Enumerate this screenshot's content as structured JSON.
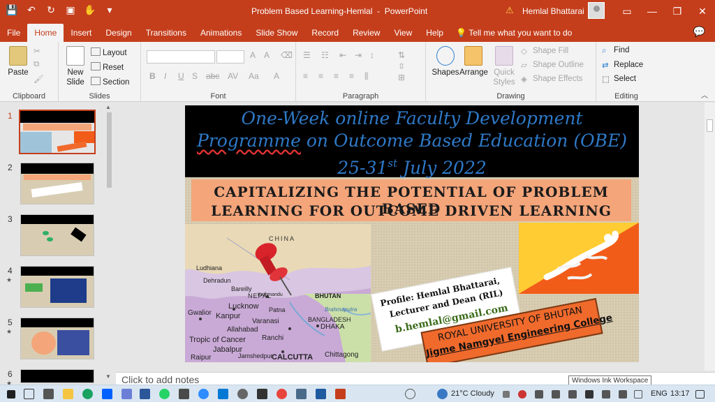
{
  "app": {
    "doc_title": "Problem Based Learning-Hemlal",
    "app_name": "PowerPoint",
    "title_separator": "-",
    "user_name": "Hemlal Bhattarai"
  },
  "tabs": [
    "File",
    "Home",
    "Insert",
    "Design",
    "Transitions",
    "Animations",
    "Slide Show",
    "Record",
    "Review",
    "View",
    "Help"
  ],
  "active_tab": "Home",
  "tell_me": "Tell me what you want to do",
  "ribbon": {
    "clipboard": {
      "paste": "Paste",
      "label": "Clipboard"
    },
    "slides": {
      "new_slide": "New",
      "new_slide2": "Slide",
      "layout": "Layout",
      "reset": "Reset",
      "section": "Section",
      "label": "Slides"
    },
    "font": {
      "label": "Font",
      "bold": "B",
      "italic": "I",
      "underline": "U",
      "strike": "S",
      "abc": "abc",
      "av": "AV",
      "aa": "Aa",
      "a": "A"
    },
    "paragraph": {
      "label": "Paragraph"
    },
    "drawing": {
      "shapes": "Shapes",
      "arrange": "Arrange",
      "quick": "Quick",
      "styles": "Styles",
      "fill": "Shape Fill",
      "outline": "Shape Outline",
      "effects": "Shape Effects",
      "label": "Drawing"
    },
    "editing": {
      "find": "Find",
      "replace": "Replace",
      "select": "Select",
      "label": "Editing"
    }
  },
  "thumbnails": [
    {
      "num": "1",
      "star": false
    },
    {
      "num": "2",
      "star": false
    },
    {
      "num": "3",
      "star": false
    },
    {
      "num": "4",
      "star": true
    },
    {
      "num": "5",
      "star": true
    },
    {
      "num": "6",
      "star": true
    }
  ],
  "selected_slide": "1",
  "slide": {
    "fdp_line1": "One-Week online Faculty Development",
    "fdp_line2a": "Programme",
    "fdp_line2b": " on Outcome Based Education (OBE)",
    "fdp_line3a": "25-31",
    "fdp_line3sup": "st",
    "fdp_line3b": " July 2022",
    "caption1": "CAPITALIZING THE POTENTIAL OF PROBLEM BASED",
    "caption2": "LEARNING FOR OUTCOME DRIVEN LEARNING",
    "profile1": "Profile:  Hemlal Bhattarai,",
    "profile2": "Lecturer and Dean (RIL)",
    "email": "b.hemlal@gmail.com",
    "rub1": "ROYAL UNIVERSITY OF BHUTAN",
    "rub2": "Jigme Namgyel Engineering College",
    "map_labels": [
      "CHINA",
      "Ludhiana",
      "Dehradun",
      "Bareilly",
      "NEPAL",
      "Lucknow",
      "Kanpur",
      "Varanasi",
      "Allahabad",
      "Tropic of Cancer",
      "Jabalpur",
      "Jamshedpur",
      "Raipur",
      "CALCUTTA",
      "Ranchi",
      "BANGLADESH",
      "DHAKA",
      "Chittagong",
      "BHUTAN",
      "Kathmandu",
      "Patna",
      "Gwalior",
      "Brahmaputra"
    ]
  },
  "notes_placeholder": "Click to add notes",
  "tooltip": "Windows Ink Workspace",
  "taskbar": {
    "weather": "21°C  Cloudy",
    "lang": "ENG",
    "time": "13:17"
  },
  "colors": {
    "accent": "#c43e1c",
    "fdp_blue": "#2e79c7",
    "salmon": "#f4a57a",
    "rub_orange": "#f06a2c"
  }
}
